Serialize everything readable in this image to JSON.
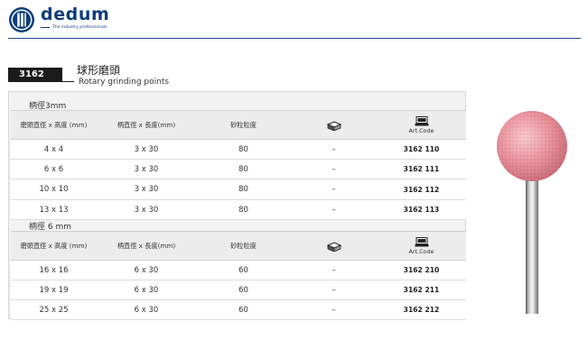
{
  "brand": {
    "name": "dedum",
    "tagline": "The industry professionals"
  },
  "product": {
    "code": "3162",
    "title_cn": "球形磨頭",
    "title_en": "Rotary grinding points"
  },
  "columns": {
    "size": "磨頭直徑 x 高度 (mm)",
    "shank": "柄直徑  x 長度(mm)",
    "grit": "砂粒粒度",
    "pack_icon": "package-icon",
    "code_icon": "machine-icon",
    "code": "Art.Code"
  },
  "sections": [
    {
      "label": "柄徑3mm",
      "rows": [
        {
          "size": "4 x 4",
          "shank": "3 x 30",
          "grit": "80",
          "pack": "–",
          "code": "3162 110"
        },
        {
          "size": "6 x 6",
          "shank": "3 x 30",
          "grit": "80",
          "pack": "–",
          "code": "3162 111"
        },
        {
          "size": "10 x 10",
          "shank": "3 x 30",
          "grit": "80",
          "pack": "–",
          "code": "3162 112"
        },
        {
          "size": "13 x 13",
          "shank": "3 x 30",
          "grit": "80",
          "pack": "–",
          "code": "3162 113"
        }
      ]
    },
    {
      "label": "柄徑 6 mm",
      "rows": [
        {
          "size": "16 x 16",
          "shank": "6 x 30",
          "grit": "60",
          "pack": "–",
          "code": "3162 210"
        },
        {
          "size": "19 x 19",
          "shank": "6 x 30",
          "grit": "60",
          "pack": "–",
          "code": "3162 211"
        },
        {
          "size": "25 x 25",
          "shank": "6 x 30",
          "grit": "60",
          "pack": "–",
          "code": "3162 212"
        }
      ]
    }
  ],
  "colors": {
    "brand_blue": "#0d3c7a",
    "badge_black": "#1b1b1b",
    "stone_pink": "#e8909a",
    "panel_grey": "#f2f2f2"
  }
}
